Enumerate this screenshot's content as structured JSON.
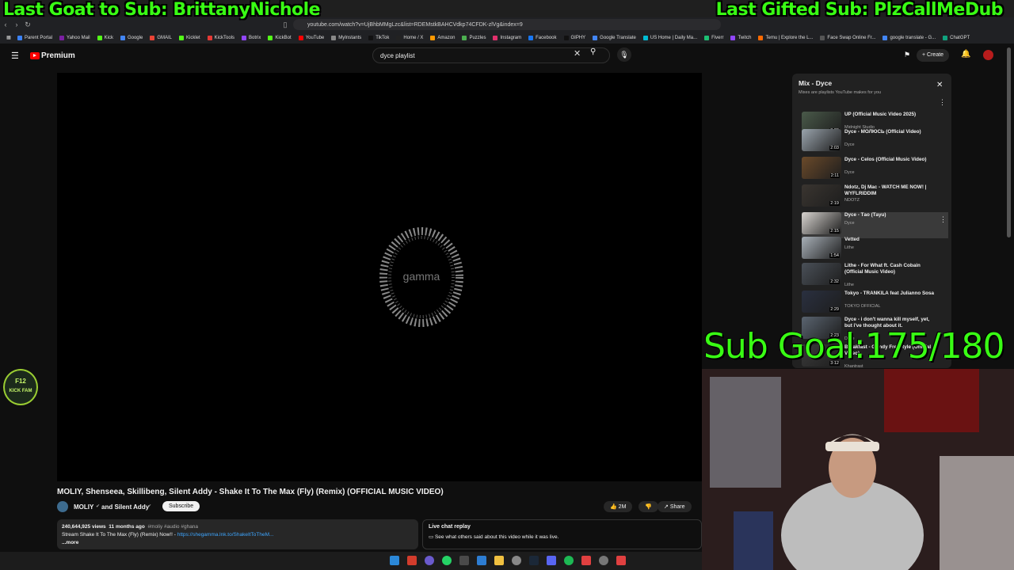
{
  "overlays": {
    "last_goat": "Last Goat to Sub: BrittanyNichole",
    "last_gifted": "Last Gifted Sub: PlzCallMeDub",
    "sub_goal": "Sub Goal:175/180",
    "badge_line1": "F12",
    "badge_line2": "KICK FAM"
  },
  "browser": {
    "url": "youtube.com/watch?v=UjBhbMMgLzc&list=RDEMstkBAHCVdkp74CFDK-zlVg&index=9",
    "bookmarks": [
      "Parent Portal",
      "Yahoo Mail",
      "Kick",
      "Google",
      "GMAIL",
      "Kicklet",
      "KickTools",
      "Botrix",
      "KickBot",
      "YouTube",
      "MyInstants",
      "TikTok",
      "Home / X",
      "Amazon",
      "Puzzles",
      "Instagram",
      "Facebook",
      "GIPHY",
      "Google Translate",
      "US Home | Daily Ma...",
      "Fiverr",
      "Twitch",
      "Temu | Explore the L...",
      "Face Swap Online Fr...",
      "google translate - G...",
      "ChatGPT"
    ]
  },
  "youtube": {
    "logo": "Premium",
    "search_value": "dyce playlist",
    "create_label": "Create"
  },
  "video": {
    "watermark": "gamma",
    "title": "MOLIY, Shenseea, Skillibeng, Silent Addy - Shake It To The Max (Fly) (Remix) (OFFICIAL MUSIC VIDEO)",
    "channel": "MOLIY",
    "channel_suffix": "and Silent Addy",
    "subscribe": "Subscribe",
    "likes": "2M",
    "share": "Share",
    "views": "240,644,925 views",
    "age": "11 months ago",
    "tags": "#moliy #audio #ghana",
    "desc_line": "Stream Shake It To The Max (Fly) (Remix) Now!! -",
    "desc_link": "https://shegamma.lnk.to/ShakeItToTheM...",
    "more": "...more",
    "chat_title": "Live chat replay",
    "chat_sub": "See what others said about this video while it was live."
  },
  "playlist": {
    "title": "Mix - Dyce",
    "subtitle": "Mixes are playlists YouTube makes for you",
    "items": [
      {
        "title": "UP (Official Music Video 2025)",
        "channel": "Midnight Studio",
        "duration": "8:20"
      },
      {
        "title": "Dyce - МОЛЮСЬ (Official Video)",
        "channel": "Dyce",
        "duration": "2:03"
      },
      {
        "title": "Dyce - Celos (Official Music Video)",
        "channel": "Dyce",
        "duration": "2:11"
      },
      {
        "title": "Ndotz, Dj Mac - WATCH ME NOW! | WYFLRIDDIM",
        "channel": "NDOTZ",
        "duration": "2:19"
      },
      {
        "title": "Dyce - Тaо (Тayu)",
        "channel": "Dyce",
        "duration": "2:15"
      },
      {
        "title": "Vetted",
        "channel": "Lithe",
        "duration": "1:54"
      },
      {
        "title": "Lithe - For What ft. Cash Cobain (Official Music Video)",
        "channel": "Lithe",
        "duration": "2:32"
      },
      {
        "title": "Tokyo - TRANKILA feat Julianno Sosa",
        "channel": "TOKYO OFFICIAL",
        "duration": "2:29"
      },
      {
        "title": "Dyce - i don't wanna kill myself, yet, but i've thought about it.",
        "channel": "Dyce",
        "duration": "2:23"
      },
      {
        "title": "Breakfast - Grindy Freestyle (Official Video)",
        "channel": "Khantrast",
        "duration": "3:12"
      }
    ]
  },
  "colors": {
    "overlay_green": "#39ff14",
    "yt_red": "#ff0000"
  }
}
